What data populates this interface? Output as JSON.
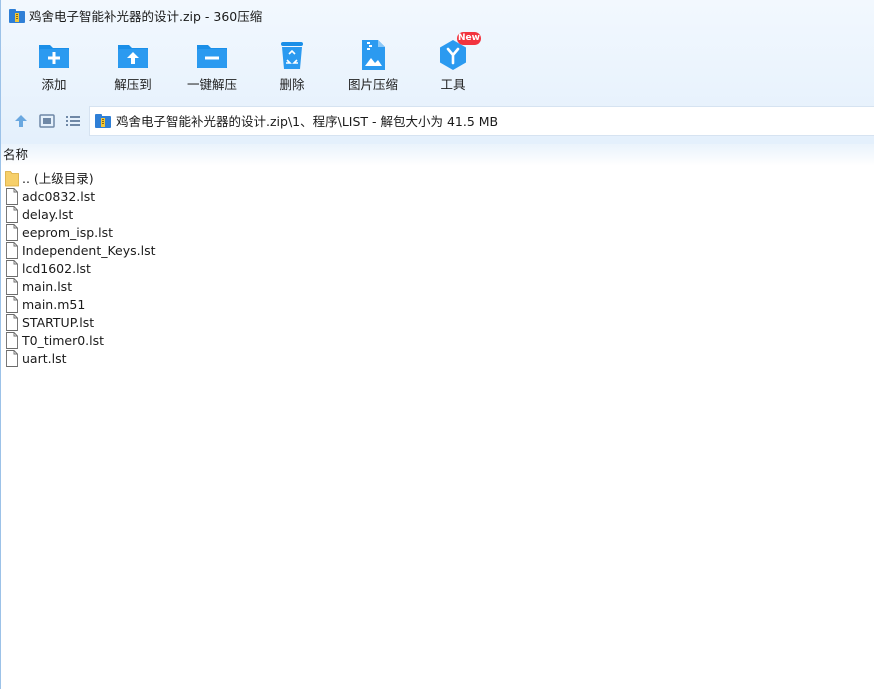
{
  "window": {
    "title": "鸡舍电子智能补光器的设计.zip - 360压缩"
  },
  "toolbar": {
    "items": [
      {
        "label": "添加",
        "icon": "add-folder-icon"
      },
      {
        "label": "解压到",
        "icon": "extract-to-icon"
      },
      {
        "label": "一键解压",
        "icon": "one-click-extract-icon"
      },
      {
        "label": "删除",
        "icon": "recycle-bin-icon"
      },
      {
        "label": "图片压缩",
        "icon": "image-compress-icon"
      },
      {
        "label": "工具",
        "icon": "tools-icon"
      }
    ],
    "new_badge": "New"
  },
  "nav": {
    "up_icon": "up-arrow-icon",
    "thumbnail_view_icon": "thumbnail-view-icon",
    "list_view_icon": "list-view-icon"
  },
  "path": {
    "text": "鸡舍电子智能补光器的设计.zip\\1、程序\\LIST - 解包大小为 41.5 MB"
  },
  "columns": {
    "name_header": "名称"
  },
  "files": [
    {
      "name": ".. (上级目录)",
      "type": "folder"
    },
    {
      "name": "adc0832.lst",
      "type": "file"
    },
    {
      "name": "delay.lst",
      "type": "file"
    },
    {
      "name": "eeprom_isp.lst",
      "type": "file"
    },
    {
      "name": "Independent_Keys.lst",
      "type": "file"
    },
    {
      "name": "lcd1602.lst",
      "type": "file"
    },
    {
      "name": "main.lst",
      "type": "file"
    },
    {
      "name": "main.m51",
      "type": "file"
    },
    {
      "name": "STARTUP.lst",
      "type": "file"
    },
    {
      "name": "T0_timer0.lst",
      "type": "file"
    },
    {
      "name": "uart.lst",
      "type": "file"
    }
  ],
  "colors": {
    "accent": "#1a8fe8",
    "badge": "#f2343f",
    "folder": "#f6cf6a"
  }
}
